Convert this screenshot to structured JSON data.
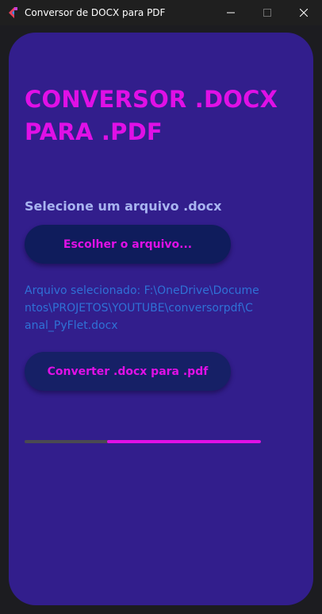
{
  "window": {
    "title": "Conversor de DOCX para PDF"
  },
  "app": {
    "heading": "CONVERSOR .DOCX PARA .PDF",
    "select_label": "Selecione um arquivo .docx",
    "choose_button": "Escolher o arquivo...",
    "selected_file_text": "Arquivo selecionado: F:\\OneDrive\\Documentos\\PROJETOS\\YOUTUBE\\conversorpdf\\Canal_PyFlet.docx",
    "convert_button": "Converter .docx para .pdf",
    "progress": {
      "start_fraction": 0.35,
      "end_fraction": 1.0
    }
  },
  "colors": {
    "accent": "#e010e6",
    "panel": "#321e8c",
    "label": "#a8b4f0",
    "path_text": "#2f71d6"
  },
  "icons": {
    "app": "flet-app-icon",
    "minimize": "minimize-icon",
    "maximize": "maximize-icon",
    "close": "close-icon"
  }
}
